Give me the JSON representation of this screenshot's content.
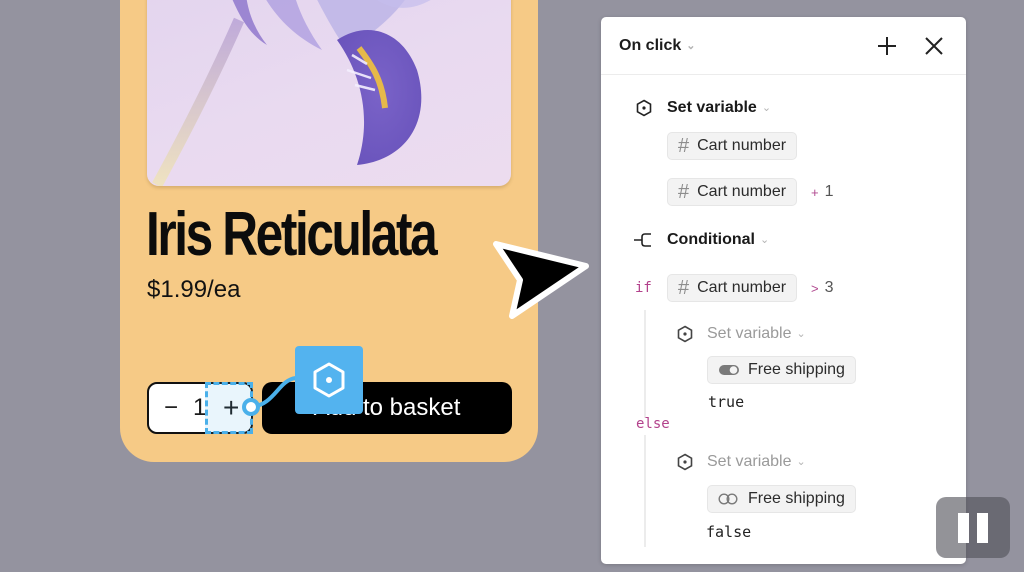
{
  "product_card": {
    "image_alt": "Iris reticulata flower",
    "title": "Iris Reticulata",
    "price": "$1.99/ea",
    "stepper": {
      "minus_label": "−",
      "quantity": "1",
      "plus_label": "+"
    },
    "basket_button_label": "Add to basket",
    "colors": {
      "card_bg": "#f6ca86",
      "selection": "#4ab0ea",
      "action_node": "#53b3ef"
    }
  },
  "interaction_panel": {
    "trigger_label": "On click",
    "header_icons": [
      "plus-icon",
      "close-icon"
    ],
    "actions": [
      {
        "type": "Set variable",
        "icon": "hexagon-dot-icon",
        "target": {
          "icon": "hash-icon",
          "name": "Cart number"
        },
        "expression": {
          "icon": "hash-icon",
          "name": "Cart number",
          "operator": "+",
          "operand": "1"
        }
      },
      {
        "type": "Conditional",
        "icon": "branch-icon",
        "if_keyword": "if",
        "condition": {
          "icon": "hash-icon",
          "name": "Cart number",
          "operator": ">",
          "operand": "3"
        },
        "then": {
          "type": "Set variable",
          "icon": "hexagon-dot-icon",
          "target": {
            "icon": "toggle-on-icon",
            "name": "Free shipping"
          },
          "value": "true"
        },
        "else_keyword": "else",
        "else": {
          "type": "Set variable",
          "icon": "hexagon-dot-icon",
          "target": {
            "icon": "toggle-off-icon",
            "name": "Free shipping"
          },
          "value": "false"
        }
      }
    ],
    "colors": {
      "keyword": "#b3428c",
      "pill_bg": "#f3f3f3"
    }
  },
  "overlay": {
    "pause_button": "pause-icon",
    "background": "#94939f"
  }
}
